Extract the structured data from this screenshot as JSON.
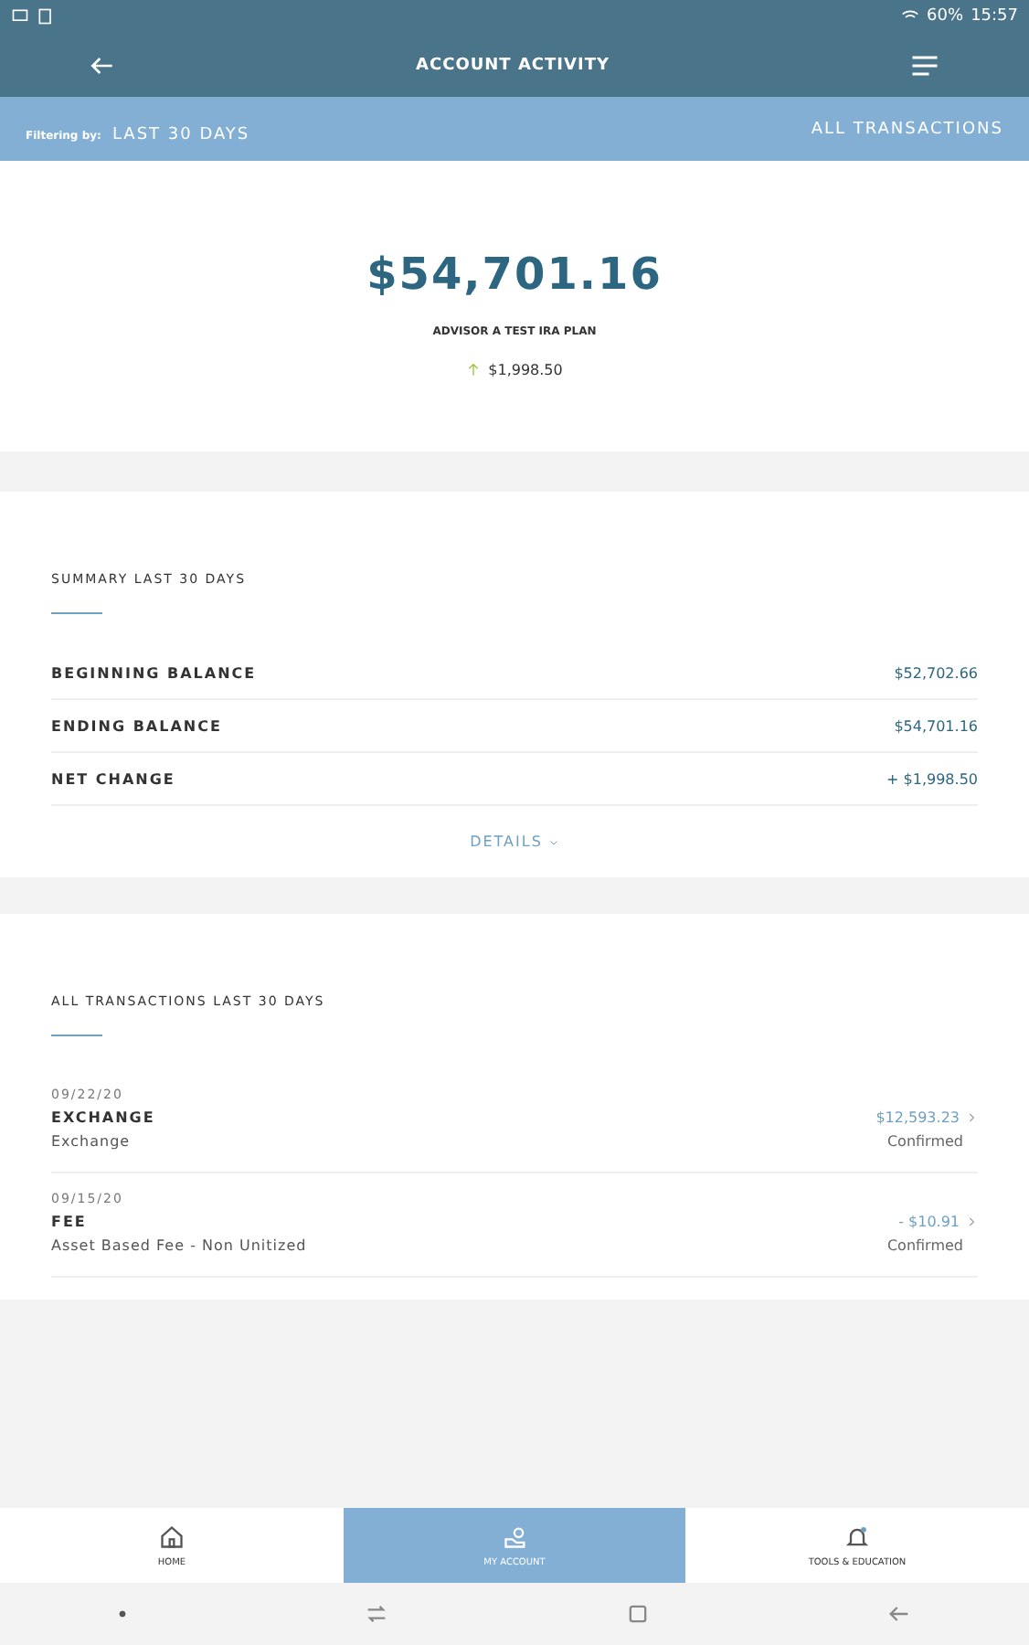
{
  "status_bar": {
    "battery": "60%",
    "time": "15:57"
  },
  "header": {
    "title": "ACCOUNT ACTIVITY"
  },
  "filter_bar": {
    "label": "Filtering by:",
    "period": "LAST 30 DAYS",
    "type": "ALL TRANSACTIONS"
  },
  "balance": {
    "amount": "$54,701.16",
    "plan": "ADVISOR A TEST IRA PLAN",
    "change": "$1,998.50",
    "kind": "gain"
  },
  "summary": {
    "title": "SUMMARY LAST 30 DAYS",
    "rows": [
      {
        "label": "BEGINNING BALANCE",
        "value": "$52,702.66"
      },
      {
        "label": "ENDING BALANCE",
        "value": "$54,701.16"
      },
      {
        "label": "NET CHANGE",
        "value": "+ $1,998.50"
      }
    ],
    "details": "DETAILS"
  },
  "transactions": {
    "title": "ALL TRANSACTIONS LAST 30 DAYS",
    "items": [
      {
        "date": "09/22/20",
        "type": "EXCHANGE",
        "description": "Exchange",
        "amount": "$12,593.23",
        "status": "Confirmed"
      },
      {
        "date": "09/15/20",
        "type": "FEE",
        "description": "Asset Based Fee - Non Unitized",
        "amount": "- $10.91",
        "status": "Confirmed"
      }
    ]
  },
  "bottom_nav": [
    {
      "label": "HOME",
      "kind": "home",
      "selected": false
    },
    {
      "label": "MY ACCOUNT",
      "kind": "account",
      "selected": true
    },
    {
      "label": "TOOLS & EDUCATION",
      "kind": "alerts",
      "selected": false
    }
  ]
}
